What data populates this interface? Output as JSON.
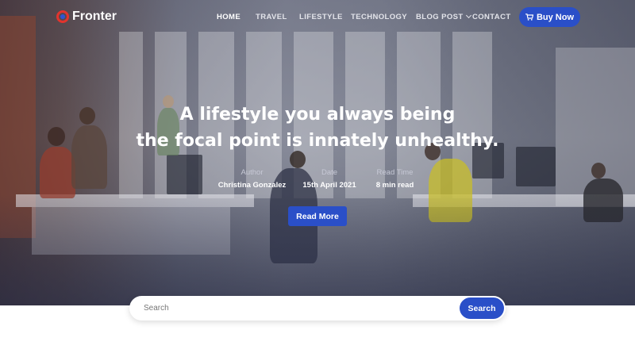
{
  "brand": {
    "name": "Fronter"
  },
  "nav": {
    "items": [
      {
        "label": "HOME"
      },
      {
        "label": "TRAVEL"
      },
      {
        "label": "LIFESTYLE"
      },
      {
        "label": "TECHNOLOGY"
      },
      {
        "label": "BLOG POST"
      },
      {
        "label": "CONTACT"
      }
    ],
    "cta_label": "Buy Now"
  },
  "hero": {
    "headline_line1": "A lifestyle you always being",
    "headline_line2": "the focal point is innately unhealthy.",
    "meta": [
      {
        "label": "Author",
        "value": "Christina Gonzalez"
      },
      {
        "label": "Date",
        "value": "15th April 2021"
      },
      {
        "label": "Read Time",
        "value": "8 min read"
      }
    ],
    "button_label": "Read More"
  },
  "search": {
    "placeholder": "Search",
    "button_label": "Search"
  },
  "colors": {
    "accent": "#2a4fc8",
    "logo_red": "#e2342d",
    "overlay": "#282c46"
  }
}
